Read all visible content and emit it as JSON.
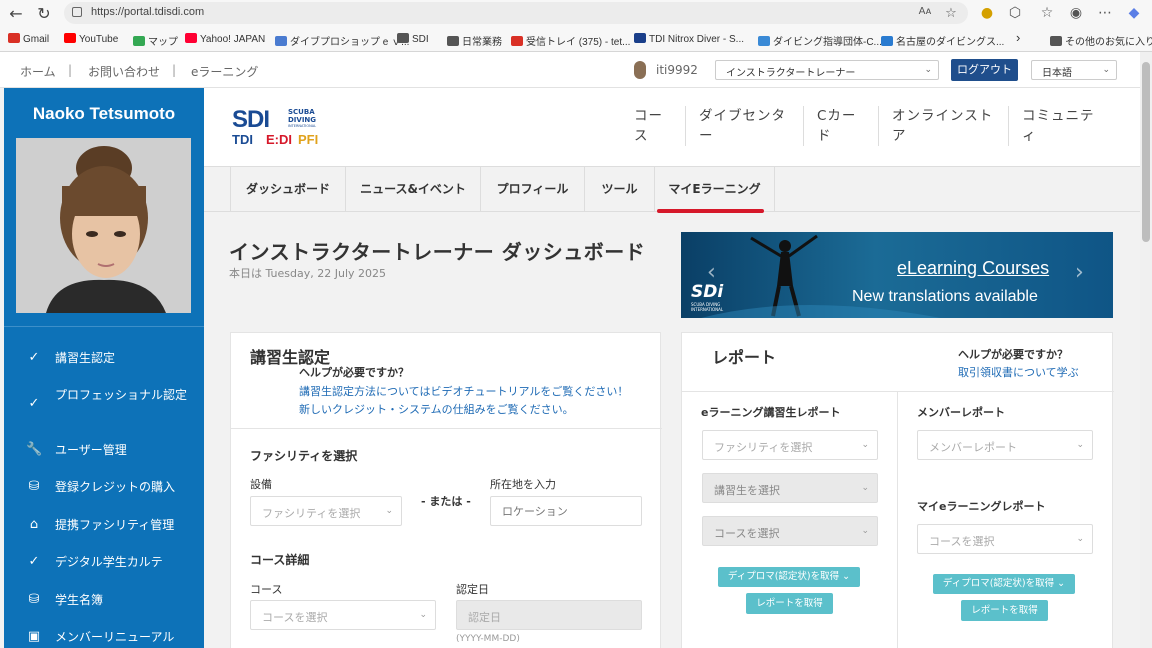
{
  "browser": {
    "url": "https://portal.tdisdi.com",
    "reader_label": "Aᴀ"
  },
  "bookmarks": [
    {
      "label": "Gmail",
      "color": "#d93025"
    },
    {
      "label": "YouTube",
      "color": "#ff0000"
    },
    {
      "label": "マップ",
      "color": "#34a853"
    },
    {
      "label": "Yahoo! JAPAN",
      "color": "#ff0033"
    },
    {
      "label": "ダイブプロショップ e ｖ...",
      "color": "#4a7bd0"
    },
    {
      "label": "SDI",
      "color": "#555555"
    },
    {
      "label": "日常業務",
      "color": "#555555"
    },
    {
      "label": "受信トレイ (375) - tet...",
      "color": "#d93025"
    },
    {
      "label": "TDI Nitrox Diver - S...",
      "color": "#1a3f8a"
    },
    {
      "label": "ダイビング指導団体-C...",
      "color": "#3a8ad6"
    },
    {
      "label": "名古屋のダイビングス...",
      "color": "#2a7bd0"
    },
    {
      "label": "その他のお気に入り",
      "color": "#555555"
    }
  ],
  "utility": {
    "home": "ホーム",
    "contact": "お問い合わせ",
    "elearning": "eラーニング",
    "sep": "|",
    "username": "iti9992",
    "role": "インストラクタートレーナー",
    "logout": "ログアウト",
    "language": "日本語"
  },
  "sidebar": {
    "name": "Naoko Tetsumoto",
    "items": [
      {
        "icon": "check-icon",
        "glyph": "✓",
        "label": "講習生認定"
      },
      {
        "icon": "check-icon",
        "glyph": "✓",
        "label": "プロフェッショナル認定"
      },
      {
        "icon": "wrench-icon",
        "glyph": "🔧",
        "label": "ユーザー管理"
      },
      {
        "icon": "coins-icon",
        "glyph": "⛁",
        "label": "登録クレジットの購入"
      },
      {
        "icon": "store-icon",
        "glyph": "⌂",
        "label": "提携ファシリティ管理"
      },
      {
        "icon": "check-icon",
        "glyph": "✓",
        "label": "デジタル学生カルテ"
      },
      {
        "icon": "coins-icon",
        "glyph": "⛁",
        "label": "学生名簿"
      },
      {
        "icon": "id-card-icon",
        "glyph": "▣",
        "label": "メンバーリニューアル"
      }
    ]
  },
  "logo": {
    "sdi": "SDI",
    "scuba": "SCUBA",
    "diving": "DIVING",
    "international": "INTERNATIONAL",
    "tdi": "TDI",
    "erdi": "E:DI",
    "pfi": "PFI"
  },
  "topnav": [
    {
      "label": "コー\nス"
    },
    {
      "label": "ダイブセンタ\nー"
    },
    {
      "label": "Cカー\nド"
    },
    {
      "label": "オンラインスト\nア"
    },
    {
      "label": "コミュニテ\nィ"
    }
  ],
  "tabs": [
    {
      "label": "ダッシュボード",
      "active": false
    },
    {
      "label": "ニュース&イベント",
      "active": false
    },
    {
      "label": "プロフィール",
      "active": false
    },
    {
      "label": "ツール",
      "active": false
    },
    {
      "label": "マイEラーニング",
      "active": true
    }
  ],
  "page": {
    "title": "インストラクタートレーナー ダッシュボード",
    "date": "本日は Tuesday, 22 July 2025"
  },
  "banner": {
    "line1": "eLearning Courses",
    "line2": "New translations available",
    "brand": "SDi",
    "brand_sub": "SCUBA DIVING\nINTERNATIONAL",
    "prev": "‹",
    "next": "›"
  },
  "cert": {
    "title": "講習生認定",
    "help_title": "ヘルプが必要ですか？",
    "help_link1": "講習生認定方法についてはビデオチュートリアルをご覧ください！",
    "help_link2": "新しいクレジット・システムの仕組みをご覧ください。",
    "facility_heading": "ファシリティを選択",
    "facility_label": "設備",
    "facility_placeholder": "ファシリティを選択",
    "or": "- または -",
    "location_label": "所在地を入力",
    "location_placeholder": "ロケーション",
    "course_heading": "コース詳細",
    "course_label": "コース",
    "course_placeholder": "コースを選択",
    "date_label": "認定日",
    "date_placeholder": "認定日",
    "date_hint": "(YYYY-MM-DD)"
  },
  "report": {
    "title": "レポート",
    "help_title": "ヘルプが必要ですか？",
    "help_link": "取引領収書について学ぶ",
    "el_heading": "eラーニング講習生レポート",
    "el_facility": "ファシリティを選択",
    "el_student": "講習生を選択",
    "el_course": "コースを選択",
    "diploma_btn": "ディプロマ(認定状)を取得 ⌄",
    "report_btn": "レポートを取得",
    "member_heading": "メンバーレポート",
    "member_placeholder": "メンバーレポート",
    "my_el_heading": "マイeラーニングレポート",
    "my_el_placeholder": "コースを選択"
  }
}
